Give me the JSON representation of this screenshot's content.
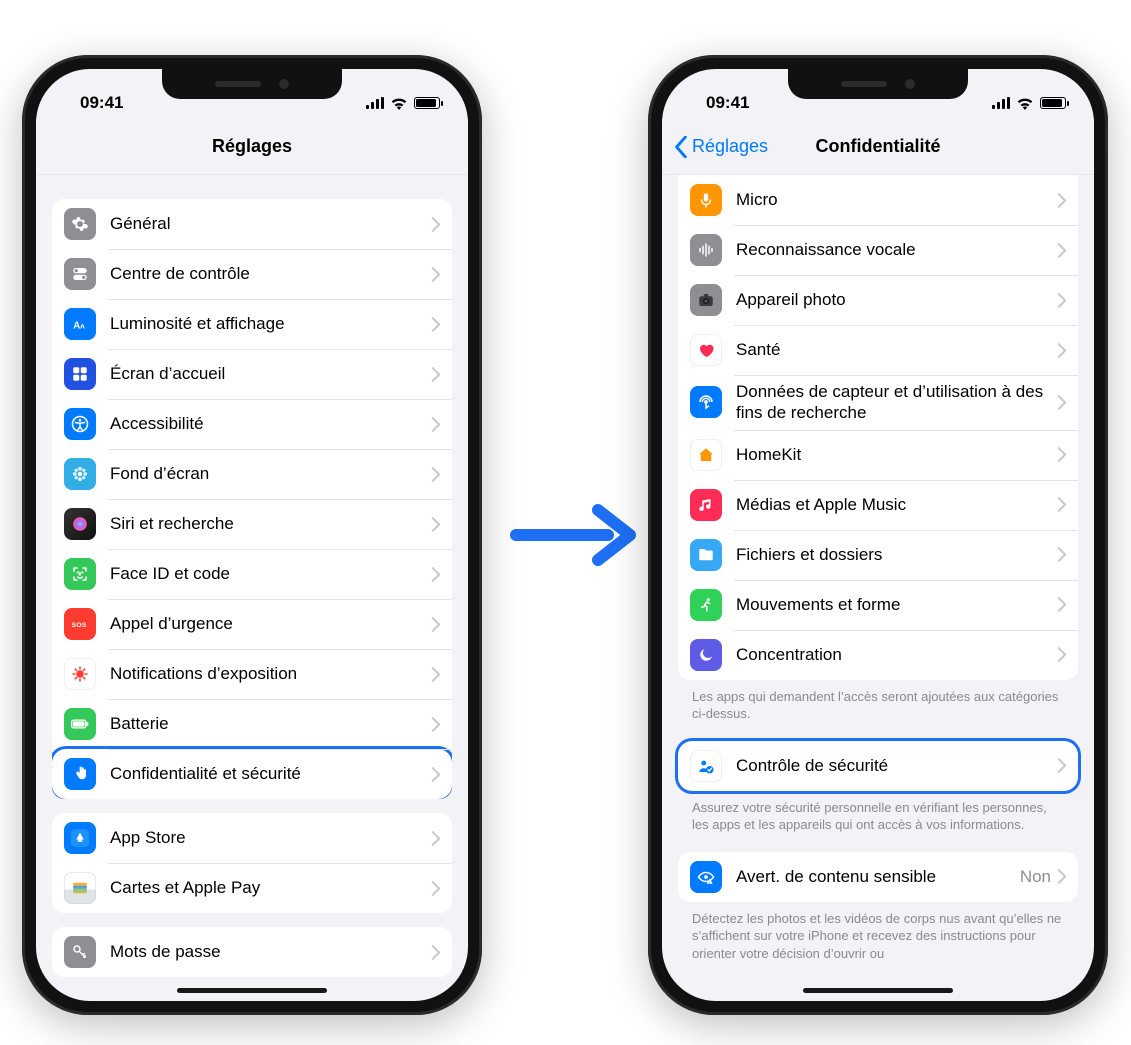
{
  "status": {
    "time": "09:41"
  },
  "arrow_color": "#1e6ff3",
  "left": {
    "title": "Réglages",
    "groups": [
      {
        "rows": [
          {
            "id": "general",
            "icon": "gear",
            "icon_bg": "bg-gray",
            "label": "Général"
          },
          {
            "id": "control-center",
            "icon": "toggles",
            "icon_bg": "bg-gray",
            "label": "Centre de contrôle"
          },
          {
            "id": "display",
            "icon": "textsize",
            "icon_bg": "bg-blue",
            "label": "Luminosité et affichage"
          },
          {
            "id": "home-screen",
            "icon": "grid",
            "icon_bg": "bg-darkblue",
            "label": "Écran d’accueil"
          },
          {
            "id": "accessibility",
            "icon": "accessibility",
            "icon_bg": "bg-blue",
            "label": "Accessibilité"
          },
          {
            "id": "wallpaper",
            "icon": "flower",
            "icon_bg": "bg-cyan",
            "label": "Fond d’écran"
          },
          {
            "id": "siri",
            "icon": "siri",
            "icon_bg": "bg-black",
            "label": "Siri et recherche"
          },
          {
            "id": "faceid",
            "icon": "faceid",
            "icon_bg": "bg-green",
            "label": "Face ID et code"
          },
          {
            "id": "sos",
            "icon": "sos",
            "icon_bg": "bg-sos",
            "label": "Appel d’urgence"
          },
          {
            "id": "exposure",
            "icon": "virus",
            "icon_bg": "bg-white",
            "label": "Notifications d’exposition"
          },
          {
            "id": "battery",
            "icon": "battery",
            "icon_bg": "bg-green",
            "label": "Batterie"
          },
          {
            "id": "privacy",
            "icon": "hand",
            "icon_bg": "bg-blue",
            "label": "Confidentialité et sécurité",
            "highlight": true
          }
        ]
      },
      {
        "rows": [
          {
            "id": "appstore",
            "icon": "appstore",
            "icon_bg": "bg-blue",
            "label": "App Store"
          },
          {
            "id": "wallet",
            "icon": "wallet",
            "icon_bg": "bg-wallet",
            "label": "Cartes et Apple Pay"
          }
        ]
      },
      {
        "rows": [
          {
            "id": "passwords",
            "icon": "key",
            "icon_bg": "bg-gray",
            "label": "Mots de passe"
          }
        ]
      }
    ]
  },
  "right": {
    "back": "Réglages",
    "title": "Confidentialité",
    "groups": [
      {
        "rows": [
          {
            "id": "mic",
            "icon": "mic",
            "icon_bg": "bg-orange",
            "label": "Micro"
          },
          {
            "id": "speech",
            "icon": "wave",
            "icon_bg": "bg-gray",
            "label": "Reconnaissance vocale"
          },
          {
            "id": "camera",
            "icon": "camera",
            "icon_bg": "bg-gray",
            "label": "Appareil photo"
          },
          {
            "id": "health",
            "icon": "heart",
            "icon_bg": "bg-white",
            "label": "Santé"
          },
          {
            "id": "research",
            "icon": "sensor",
            "icon_bg": "bg-blue",
            "label": "Données de capteur et d’utilisation à des fins de recherche"
          },
          {
            "id": "homekit",
            "icon": "home",
            "icon_bg": "bg-white",
            "label": "HomeKit"
          },
          {
            "id": "music",
            "icon": "music",
            "icon_bg": "bg-pink",
            "label": "Médias et Apple Music"
          },
          {
            "id": "files",
            "icon": "folder",
            "icon_bg": "bg-folder",
            "label": "Fichiers et dossiers"
          },
          {
            "id": "motion",
            "icon": "motion",
            "icon_bg": "bg-teal",
            "label": "Mouvements et forme"
          },
          {
            "id": "focus",
            "icon": "moon",
            "icon_bg": "bg-purple",
            "label": "Concentration"
          }
        ],
        "footer": "Les apps qui demandent l’accès seront ajoutées aux catégories ci-dessus."
      },
      {
        "highlight": true,
        "rows": [
          {
            "id": "safety-check",
            "icon": "person-check",
            "icon_bg": "bg-white",
            "icon_color": "#007aff",
            "label": "Contrôle de sécurité"
          }
        ],
        "footer": "Assurez votre sécurité personnelle en vérifiant les personnes, les apps et les appareils qui ont accès à vos informations."
      },
      {
        "rows": [
          {
            "id": "sensitive",
            "icon": "eye-warn",
            "icon_bg": "bg-blue",
            "label": "Avert. de contenu sensible",
            "value": "Non"
          }
        ],
        "footer": "Détectez les photos et les vidéos de corps nus avant qu’elles ne s’affichent sur votre iPhone et recevez des instructions pour orienter votre décision d’ouvrir ou"
      }
    ]
  }
}
